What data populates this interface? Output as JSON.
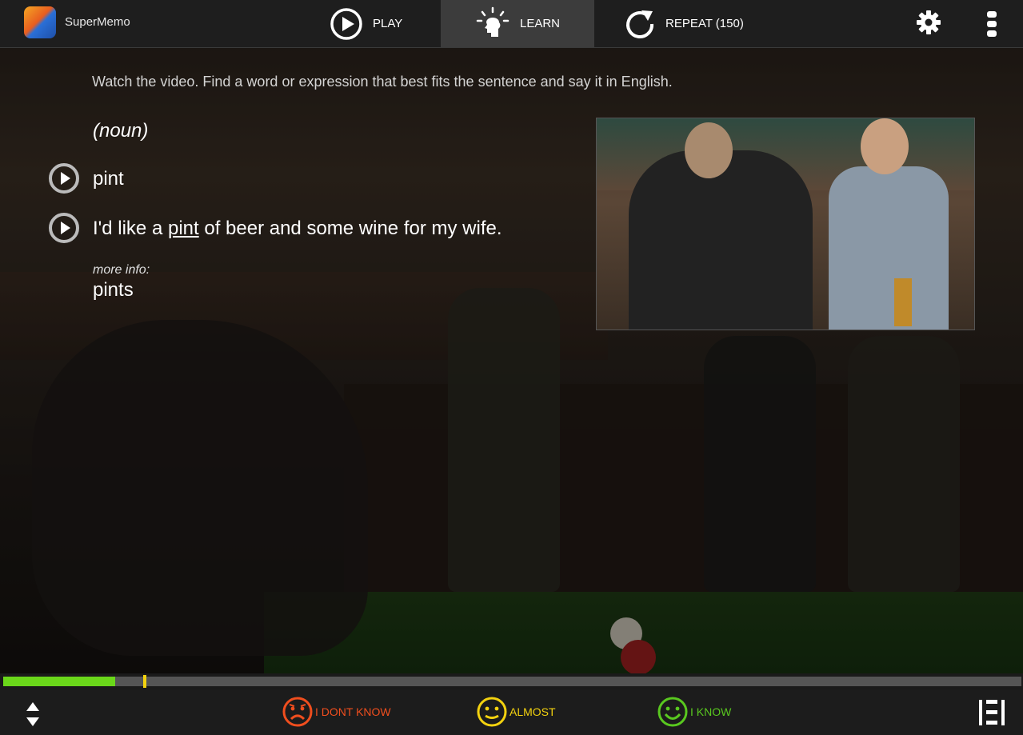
{
  "app": {
    "name": "SuperMemo"
  },
  "nav": {
    "play": "PLAY",
    "learn": "LEARN",
    "repeat": "REPEAT (150)"
  },
  "card": {
    "instruction": "Watch the video. Find a word or expression that best fits the sentence and say it in English.",
    "part_of_speech": "(noun)",
    "word": "pint",
    "sentence_before": "I'd like a ",
    "sentence_highlight": "pint",
    "sentence_after": " of beer and some wine for my wife.",
    "more_info_label": "more info:",
    "more_info_value": "pints"
  },
  "progress": {
    "fraction": 0.11
  },
  "rating": {
    "dont_know": "I DONT KNOW",
    "almost": "ALMOST",
    "know": "I KNOW"
  },
  "colors": {
    "progress_fill": "#6ad71a",
    "progress_marker": "#f3d20f",
    "dont_know": "#f04e1e",
    "almost": "#f3d20f",
    "know": "#59c81f"
  }
}
